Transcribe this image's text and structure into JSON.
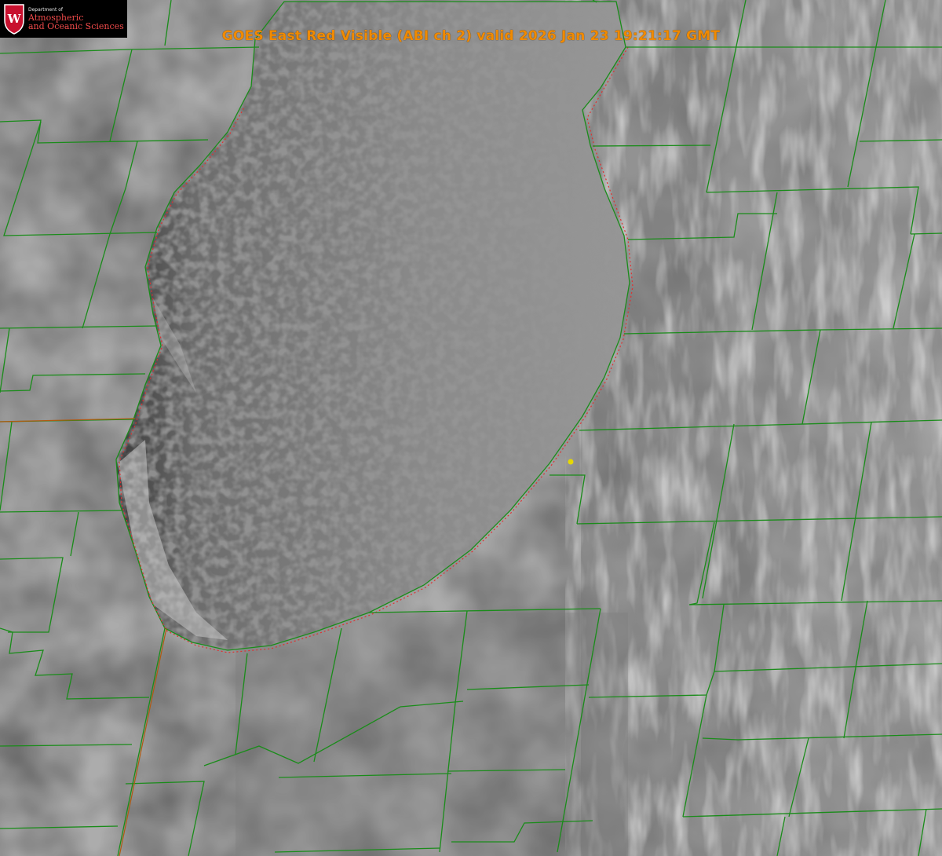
{
  "title": "GOES East Red Visible (ABI ch 2) valid 2026 Jan 23 19:21:17 GMT",
  "logo": {
    "dept": "Department of",
    "line1": "Atmospheric",
    "line2": "and Oceanic Sciences",
    "shield_letter": "W"
  },
  "colors": {
    "title": "#f08a00",
    "county_lines": "#1a8c1a",
    "shoreline_dotted": "#e03030",
    "state_line": "#b05a10",
    "marker": "#e6d800",
    "logo_red": "#c8102e"
  }
}
